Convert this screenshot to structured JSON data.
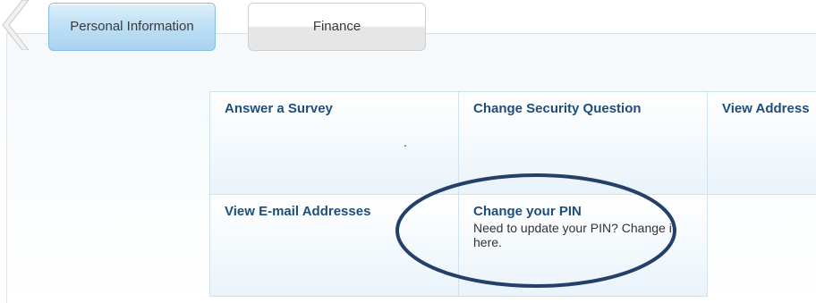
{
  "tabs": [
    {
      "label": "Personal Information",
      "active": true
    },
    {
      "label": "Finance",
      "active": false
    }
  ],
  "tiles": [
    {
      "title": "Answer a Survey",
      "description": "."
    },
    {
      "title": "Change Security Question",
      "description": ""
    },
    {
      "title": "View Address",
      "description": ""
    },
    {
      "title": "View E-mail Addresses",
      "description": ""
    },
    {
      "title": "Change your PIN",
      "description": "Need to update your PIN? Change it here."
    }
  ],
  "colors": {
    "tile_title": "#1e4e7c",
    "highlight_ellipse": "#243f6a",
    "active_tab": "#a9d3ef"
  },
  "icons": {
    "back": "left-arrow-chevron-icon"
  }
}
